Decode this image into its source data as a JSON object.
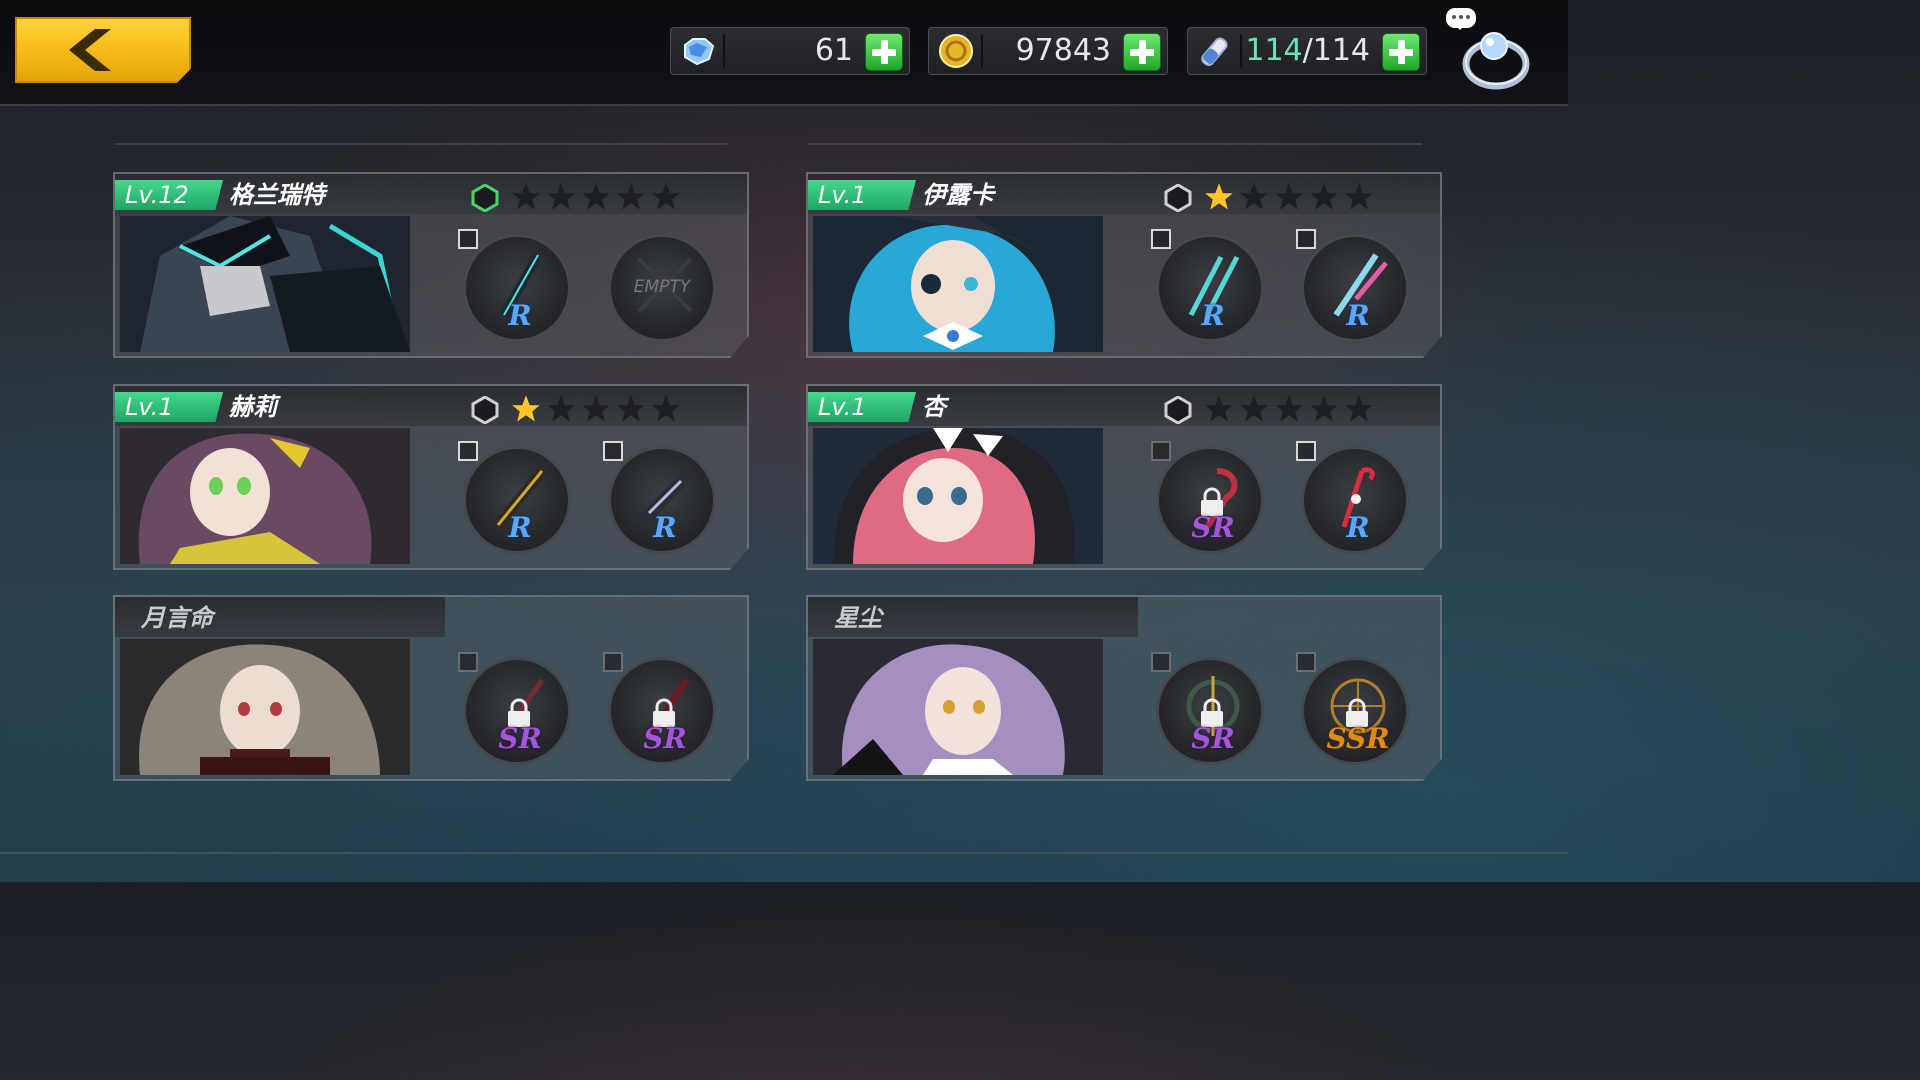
{
  "header": {
    "resources": [
      {
        "name": "diamonds",
        "icon": "diamond-icon",
        "value": "61"
      },
      {
        "name": "coins",
        "icon": "coin-icon",
        "value": "97843"
      },
      {
        "name": "stamina",
        "icon": "stamina-icon",
        "current": "114",
        "separator": "/",
        "max": "114"
      }
    ]
  },
  "cards": [
    {
      "level": "Lv.12",
      "name": "格兰瑞特",
      "unlocked": true,
      "stars": 0,
      "hex_color": "#49d36a",
      "slots": [
        {
          "rarity": "R",
          "locked": false
        },
        {
          "empty": true,
          "label": "EMPTY"
        }
      ]
    },
    {
      "level": "Lv.1",
      "name": "伊露卡",
      "unlocked": true,
      "stars": 1,
      "hex_color": "#d0d0d0",
      "slots": [
        {
          "rarity": "R",
          "locked": false
        },
        {
          "rarity": "R",
          "locked": false
        }
      ]
    },
    {
      "level": "Lv.1",
      "name": "赫莉",
      "unlocked": true,
      "stars": 1,
      "hex_color": "#d0d0d0",
      "slots": [
        {
          "rarity": "R",
          "locked": false
        },
        {
          "rarity": "R",
          "locked": false
        }
      ]
    },
    {
      "level": "Lv.1",
      "name": "杏",
      "unlocked": true,
      "stars": 0,
      "hex_color": "#d0d0d0",
      "slots": [
        {
          "rarity": "SR",
          "locked": true
        },
        {
          "rarity": "R",
          "locked": false
        }
      ]
    },
    {
      "name": "月言命",
      "unlocked": false,
      "slots": [
        {
          "rarity": "SR",
          "locked": true
        },
        {
          "rarity": "SR",
          "locked": true
        }
      ]
    },
    {
      "name": "星尘",
      "unlocked": false,
      "slots": [
        {
          "rarity": "SR",
          "locked": true
        },
        {
          "rarity": "SSR",
          "locked": true
        }
      ]
    }
  ],
  "colors": {
    "accent_green": "#2fc777",
    "back_button": "#f2b715",
    "star_active": "#ffc629",
    "star_inactive": "#1e1f22"
  }
}
